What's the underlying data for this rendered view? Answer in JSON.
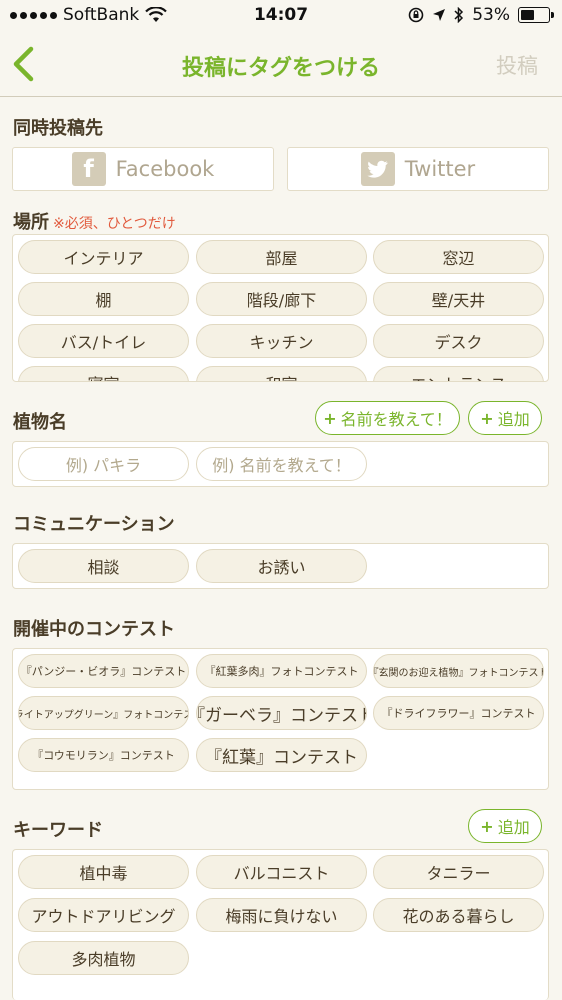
{
  "status": {
    "carrier": "SoftBank",
    "time": "14:07",
    "battery": "53%",
    "battery_level": 0.53
  },
  "nav": {
    "title": "投稿にタグをつける",
    "post": "投稿"
  },
  "share": {
    "label": "同時投稿先",
    "facebook": "Facebook",
    "twitter": "Twitter"
  },
  "place": {
    "label": "場所",
    "note": "※必須、ひとつだけ",
    "items": [
      "インテリア",
      "部屋",
      "窓辺",
      "棚",
      "階段/廊下",
      "壁/天井",
      "バス/トイレ",
      "キッチン",
      "デスク",
      "寝室",
      "和室",
      "エントランス"
    ]
  },
  "plant": {
    "label": "植物名",
    "ask_button": "名前を教えて！",
    "add_button": "追加",
    "placeholder1": "例) パキラ",
    "placeholder2": "例) 名前を教えて！"
  },
  "communication": {
    "label": "コミュニケーション",
    "items": [
      "相談",
      "お誘い"
    ]
  },
  "contest": {
    "label": "開催中のコンテスト",
    "items": [
      "『パンジー・ビオラ』コンテスト",
      "『紅葉多肉』フォトコンテスト",
      "『玄関のお迎え植物』フォトコンテスト",
      "『ライトアップグリーン』フォトコンテスト",
      "『ガーベラ』コンテスト",
      "『ドライフラワー』コンテスト",
      "『コウモリラン』コンテスト",
      "『紅葉』コンテスト"
    ]
  },
  "keyword": {
    "label": "キーワード",
    "add_button": "追加",
    "items": [
      "植中毒",
      "バルコニスト",
      "タニラー",
      "アウトドアリビング",
      "梅雨に負けない",
      "花のある暮らし",
      "多肉植物"
    ]
  },
  "colors": {
    "accent": "#7ab52c",
    "note": "#e15a3d",
    "pill_bg": "#f5f1e4"
  }
}
